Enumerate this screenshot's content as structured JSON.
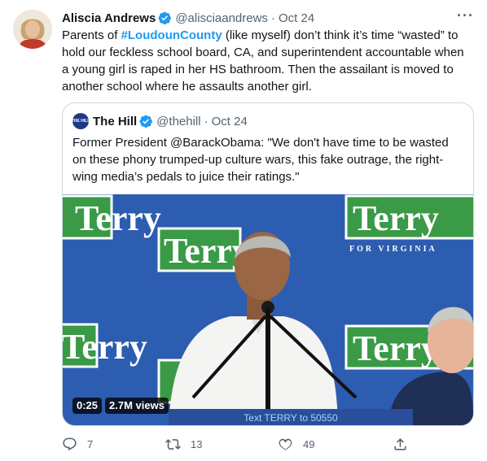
{
  "tweet": {
    "author_name": "Aliscia Andrews",
    "author_handle": "@alisciaandrews",
    "separator": "·",
    "date": "Oct 24",
    "more_label": "···",
    "text_before": "Parents of ",
    "hashtag": "#LoudounCounty",
    "text_after": " (like myself) don’t think it’s time “wasted” to hold our feckless school board, CA, and superintendent accountable when a young girl is raped in her HS bathroom. Then the assailant is moved to another school where he assaults another girl."
  },
  "quote": {
    "author_name": "The Hill",
    "author_handle": "@thehill",
    "separator": "·",
    "date": "Oct 24",
    "avatar_text": "THE HILL",
    "text": "Former President @BarackObama: \"We don't have time to be wasted on these phony trumped-up culture wars, this fake outrage, the right-wing media’s pedals to juice their ratings.\"",
    "video": {
      "duration": "0:25",
      "views": "2.7M views",
      "sign_word": "Terry",
      "sign_subtitle": "FOR VIRGINIA",
      "banner_text": "Text TERRY to 50550"
    }
  },
  "actions": {
    "reply_count": "7",
    "retweet_count": "13",
    "like_count": "49"
  },
  "colors": {
    "accent": "#1d9bf0",
    "secondary_text": "#536471",
    "border": "#cfd9de",
    "sign_green": "#3a9a46",
    "backdrop_blue": "#2a5aa8"
  },
  "icons": [
    "verified-badge-icon",
    "more-icon",
    "reply-icon",
    "retweet-icon",
    "like-icon",
    "share-icon"
  ]
}
